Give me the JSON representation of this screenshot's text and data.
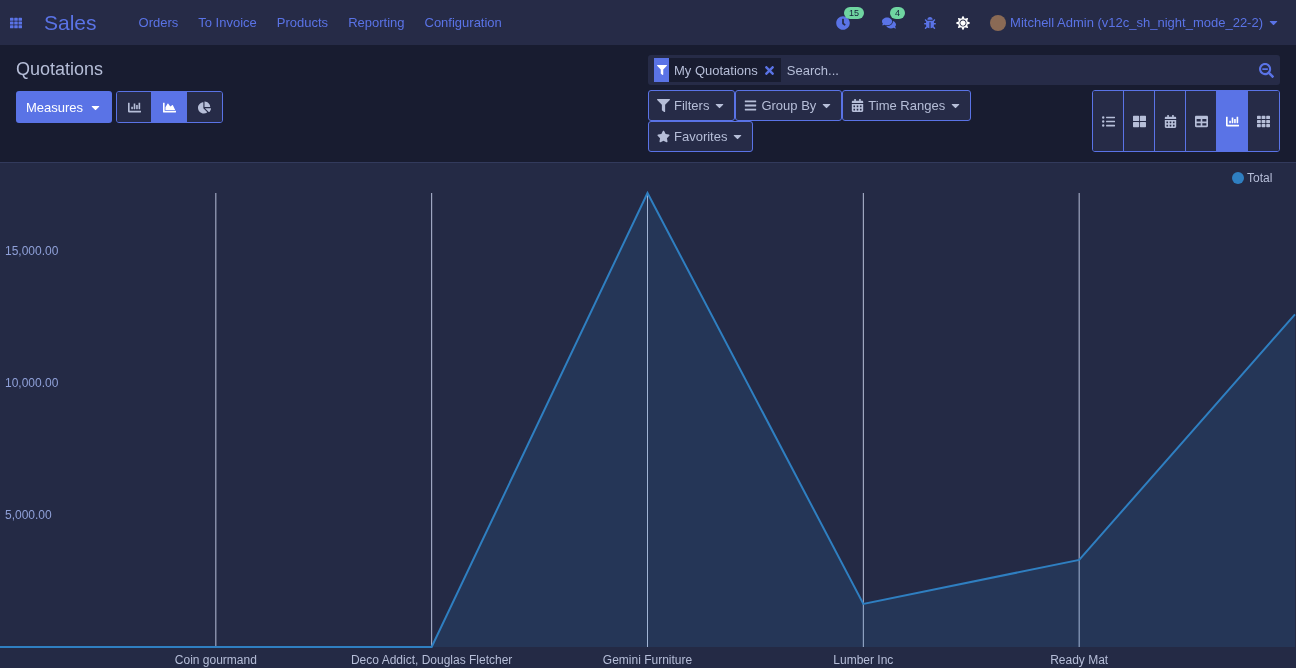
{
  "navbar": {
    "app_name": "Sales",
    "menu": [
      "Orders",
      "To Invoice",
      "Products",
      "Reporting",
      "Configuration"
    ],
    "activity_count": "15",
    "message_count": "4",
    "user": "Mitchell Admin (v12c_sh_night_mode_22-2)"
  },
  "control_panel": {
    "title": "Quotations",
    "measures": "Measures",
    "chart_types": [
      {
        "kind": "bar",
        "selected": false
      },
      {
        "kind": "line",
        "selected": true
      },
      {
        "kind": "pie",
        "selected": false
      }
    ],
    "facet": "My Quotations",
    "search": {
      "placeholder": "Search..."
    },
    "search_buttons": [
      {
        "kind": "filter",
        "label": "Filters"
      },
      {
        "kind": "group",
        "label": "Group By"
      },
      {
        "kind": "calendar",
        "label": "Time Ranges"
      },
      {
        "kind": "star",
        "label": "Favorites"
      }
    ],
    "views": [
      {
        "kind": "list",
        "selected": false
      },
      {
        "kind": "kanban",
        "selected": false
      },
      {
        "kind": "calendar",
        "selected": false
      },
      {
        "kind": "pivot",
        "selected": false
      },
      {
        "kind": "graph",
        "selected": true
      },
      {
        "kind": "grid",
        "selected": false
      }
    ]
  },
  "chart_data": {
    "type": "area",
    "grid": true,
    "categories": [
      null,
      "Coin gourmand",
      "Deco Addict, Douglas Fletcher",
      "Gemini Furniture",
      "Lumber Inc",
      "Ready Mat",
      null
    ],
    "ylim": [
      0,
      17200
    ],
    "yticks": [
      {
        "value": 5000,
        "label": "5,000.00"
      },
      {
        "value": 10000,
        "label": "10,000.00"
      },
      {
        "value": 15000,
        "label": "15,000.00"
      }
    ],
    "series": [
      {
        "name": "Total",
        "color": "#2f7fc1",
        "values": [
          0,
          0,
          0,
          17200,
          1630,
          3300,
          12600
        ]
      }
    ]
  }
}
